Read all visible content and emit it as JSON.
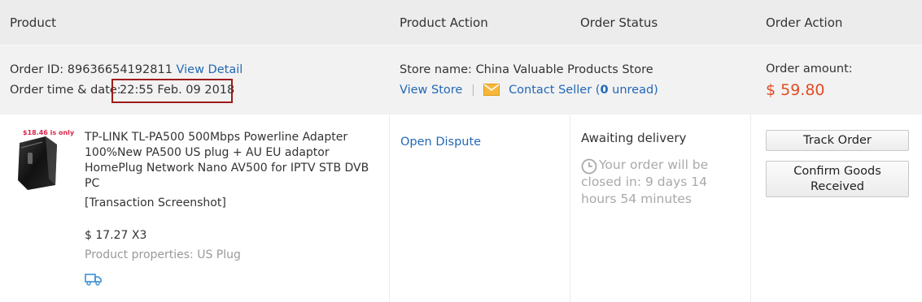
{
  "header": {
    "col_product": "Product",
    "col_product_action": "Product Action",
    "col_order_status": "Order Status",
    "col_order_action": "Order Action"
  },
  "order": {
    "id_label": "Order ID:",
    "id_value": "89636654192811",
    "view_detail": "View Detail",
    "time_label": "Order time & date:",
    "time_value": "22:55 Feb. 09 2018",
    "store_label": "Store name:",
    "store_value": "China Valuable Products Store",
    "view_store": "View Store",
    "separator": "|",
    "contact_seller": "Contact Seller",
    "unread_open": "(",
    "unread_count": "0",
    "unread_text": " unread)",
    "amount_label": "Order amount:",
    "amount_value": "$ 59.80"
  },
  "product": {
    "thumb_text": "$18.46 is only",
    "title": "TP-LINK TL-PA500 500Mbps Powerline Adapter 100%New PA500 US plug + AU EU adaptor HomePlug Network Nano AV500 for IPTV STB DVB PC",
    "snapshot": "[Transaction Screenshot]",
    "price_qty": "$ 17.27 X3",
    "properties": "Product properties: US Plug"
  },
  "product_action": {
    "open_dispute": "Open Dispute"
  },
  "order_status": {
    "status": "Awaiting delivery",
    "note": "Your order will be closed in: 9 days 14 hours 54 minutes"
  },
  "order_action": {
    "track_order": "Track Order",
    "confirm_line1": "Confirm Goods",
    "confirm_line2": "Received"
  },
  "colors": {
    "link": "#2368b7",
    "amount": "#e24b24",
    "highlight_border": "#9e1b1b"
  }
}
